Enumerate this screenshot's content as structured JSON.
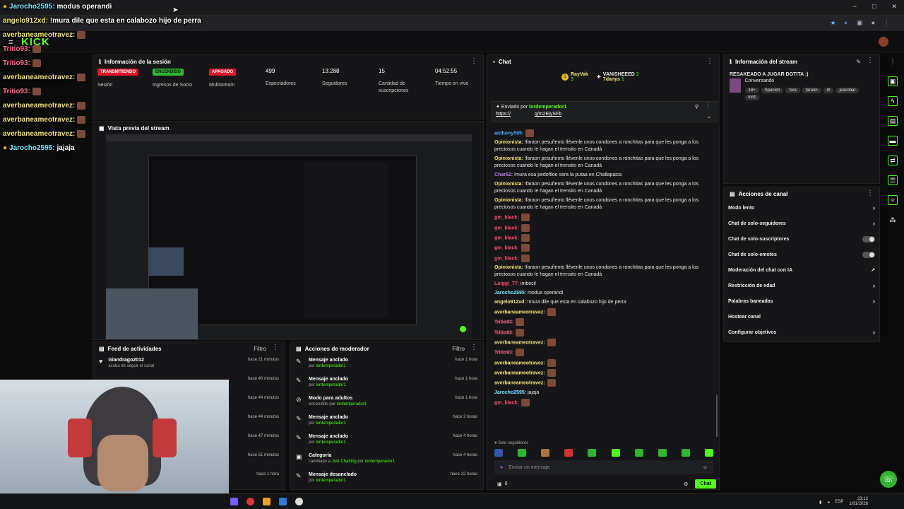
{
  "titlebar": {
    "win_min": "−",
    "win_max": "□",
    "win_close": "✕"
  },
  "overlay_chat": [
    {
      "user": "Jarocho2595:",
      "text": "modus operandi",
      "color": "#79e6ff",
      "badges": true
    },
    {
      "user": "angelo912xd:",
      "text": "!mura dile que esta en calabozo hijo de perra",
      "color": "#f0e37a",
      "badges": false
    },
    {
      "user": "averbaneameotravez:",
      "text": "",
      "color": "#f0e37a",
      "emote": true
    },
    {
      "user": "Tritio93:",
      "text": "",
      "color": "#ff6b8b",
      "emote": true
    },
    {
      "user": "Tritio93:",
      "text": "",
      "color": "#ff6b8b",
      "emote": true
    },
    {
      "user": "averbaneameotravez:",
      "text": "",
      "color": "#f0e37a",
      "emote": true
    },
    {
      "user": "Tritio93:",
      "text": "",
      "color": "#ff6b8b",
      "emote": true
    },
    {
      "user": "averbaneameotravez:",
      "text": "",
      "color": "#f0e37a",
      "emote": true
    },
    {
      "user": "averbaneameotravez:",
      "text": "",
      "color": "#f0e37a",
      "emote": true
    },
    {
      "user": "averbaneameotravez:",
      "text": "",
      "color": "#f0e37a",
      "emote": true
    },
    {
      "user": "Jarocho2595:",
      "text": "jajaja",
      "color": "#79e6ff",
      "badges": true
    }
  ],
  "logo": "KICK",
  "stream_info": {
    "title": "Información de la sesión",
    "stats": [
      {
        "badge": "TRANSMITIENDO",
        "badge_color": "#e0162b",
        "label": "Sesión"
      },
      {
        "badge": "ENCENDIDO",
        "badge_color": "#2fb52f",
        "label": "Ingresos de Socio"
      },
      {
        "badge": "APAGADO",
        "badge_color": "#e0162b",
        "label": "Multistream"
      },
      {
        "value": "499",
        "label": "Espectadores"
      },
      {
        "value": "13.288",
        "label": "Seguidores"
      },
      {
        "value": "15",
        "label": "Cantidad de suscripciones"
      },
      {
        "value": "04:52:55",
        "label": "Tiempo en vivo"
      }
    ]
  },
  "preview": {
    "title": "Vista previa del stream"
  },
  "feed": {
    "title": "Feed de actividades",
    "filter": "Filtro",
    "rows": [
      {
        "title": "Giandrago2012",
        "sub": "acaba de seguir el canal",
        "time": "hace 21 minutos"
      },
      {
        "title": "",
        "sub": "",
        "time": "hace 40 minutos"
      },
      {
        "title": "",
        "sub": "",
        "time": "hace 44 minutos"
      },
      {
        "title": "",
        "sub": "",
        "time": "hace 44 minutos"
      },
      {
        "title": "",
        "sub": "",
        "time": "hace 47 minutos"
      },
      {
        "title": "",
        "sub": "",
        "time": "hace 51 minutos"
      },
      {
        "title": "",
        "sub": "",
        "time": "hace 1 hora"
      }
    ]
  },
  "mod_actions": {
    "title": "Acciones de moderador",
    "filter": "Filtro",
    "rows": [
      {
        "title": "Mensaje anclado",
        "by": "por",
        "user": "lordemperador1",
        "time": "hace 1 hora"
      },
      {
        "title": "Mensaje anclado",
        "by": "por",
        "user": "lordemperador1",
        "time": "hace 1 hora"
      },
      {
        "title": "Modo para adultos",
        "by": "encendido por",
        "user": "lordemperador1",
        "time": "hace 1 hora"
      },
      {
        "title": "Mensaje anclado",
        "by": "por",
        "user": "lordemperador1",
        "time": "hace 3 horas"
      },
      {
        "title": "Mensaje anclado",
        "by": "por",
        "user": "lordemperador1",
        "time": "hace 4 horas"
      },
      {
        "title": "Categoría",
        "by": "cambiado a",
        "user": "Just Chatting",
        "by2": "por",
        "user2": "lordemperador1",
        "time": "hace 4 horas"
      },
      {
        "title": "Mensaje desanclado",
        "by": "por",
        "user": "lordemperador1",
        "time": "hace 22 horas"
      }
    ]
  },
  "chat": {
    "title": "Chat",
    "top_gifters": [
      {
        "name": "RayVak",
        "count": "3"
      },
      {
        "name": "VANISHEEED",
        "count": "2"
      },
      {
        "name": "7danys",
        "count": "1"
      }
    ],
    "pinned": {
      "label": "Enviado por",
      "user": "lordemperador1",
      "link": "https://",
      "link_tail": "g/m2EjySFb"
    },
    "messages": [
      {
        "user": "anthony595:",
        "text": "",
        "color": "#4aa8ff",
        "emote": true
      },
      {
        "user": "Opinionista:",
        "text": "!faraon pesuñento llévenle unos condones a ronchitas para que les ponga a los preciosos cuando le hagan el trensito en Canadá",
        "color": "#f0e37a"
      },
      {
        "user": "Opinionista:",
        "text": "!faraon pesuñento llévenle unos condones a ronchitas para que les ponga a los preciosos cuando le hagan el trensito en Canadá",
        "color": "#f0e37a"
      },
      {
        "user": "Char52:",
        "text": "!mura esa pedofiloo sera la putaa en Challapaica",
        "color": "#b77bff"
      },
      {
        "user": "Opinionista:",
        "text": "!faraon pesuñento llévenle unos condones a ronchitas para que les ponga a los preciosos cuando le hagan el trensito en Canadá",
        "color": "#f0e37a"
      },
      {
        "user": "Opinionista:",
        "text": "!faraon pesuñento llévenle unos condones a ronchitas para que les ponga a los preciosos cuando le hagan el trensito en Canadá",
        "color": "#f0e37a"
      },
      {
        "user": "gm_black:",
        "text": "",
        "color": "#ff4d6d",
        "emote": true
      },
      {
        "user": "gm_black:",
        "text": "",
        "color": "#ff4d6d",
        "emote": true
      },
      {
        "user": "gm_black:",
        "text": "",
        "color": "#ff4d6d",
        "emote": true
      },
      {
        "user": "gm_black:",
        "text": "",
        "color": "#ff4d6d",
        "emote": true
      },
      {
        "user": "gm_black:",
        "text": "",
        "color": "#ff4d6d",
        "emote": true
      },
      {
        "user": "Opinionista:",
        "text": "!faraon pesuñento llévenle unos condones a ronchitas para que les ponga a los preciosos cuando le hagan el trensito en Canadá",
        "color": "#f0e37a"
      },
      {
        "user": "Luiggi_77:",
        "text": "imbecil",
        "color": "#ff4d6d"
      },
      {
        "user": "Jarocho2595:",
        "text": "modus operandi",
        "color": "#79e6ff"
      },
      {
        "user": "angelo912xd:",
        "text": "!mura dile que esta en calabozo hijo de perra",
        "color": "#f0e37a"
      },
      {
        "user": "averbaneameotravez:",
        "text": "",
        "color": "#f0e37a",
        "emote": true
      },
      {
        "user": "Tritio93:",
        "text": "",
        "color": "#ff6b8b",
        "emote": true
      },
      {
        "user": "Tritio93:",
        "text": "",
        "color": "#ff6b8b",
        "emote": true
      },
      {
        "user": "averbaneameotravez:",
        "text": "",
        "color": "#f0e37a",
        "emote": true
      },
      {
        "user": "Tritio93:",
        "text": "",
        "color": "#ff6b8b",
        "emote": true
      },
      {
        "user": "averbaneameotravez:",
        "text": "",
        "color": "#f0e37a",
        "emote": true
      },
      {
        "user": "averbaneameotravez:",
        "text": "",
        "color": "#f0e37a",
        "emote": true
      },
      {
        "user": "averbaneameotravez:",
        "text": "",
        "color": "#f0e37a",
        "emote": true
      },
      {
        "user": "Jarocho2595:",
        "text": "jajaja",
        "color": "#79e6ff"
      },
      {
        "user": "gm_black:",
        "text": "",
        "color": "#ff4d6d",
        "emote": true
      }
    ],
    "followers_only": "Solo seguidores",
    "input_placeholder": "Enviar un mensaje",
    "points": "0",
    "send": "Chat"
  },
  "stream_panel": {
    "title": "Información del stream",
    "stream_title": "RESAKEADO A JUGAR DOTITA :)",
    "category": "Conversando",
    "tags": [
      "18+",
      "Spanish",
      "fara",
      "faraon",
      "lrl",
      "jeacobar",
      "lord"
    ]
  },
  "channel_actions": {
    "title": "Acciones de canal",
    "items": [
      {
        "label": "Modo lento",
        "type": "arrow"
      },
      {
        "label": "Chat de solo-seguidores",
        "type": "arrow"
      },
      {
        "label": "Chat de solo-suscriptores",
        "type": "toggle"
      },
      {
        "label": "Chat de solo-emotes",
        "type": "toggle"
      },
      {
        "label": "Moderación del chat con IA",
        "type": "ext"
      },
      {
        "label": "Restricción de edad",
        "type": "arrow"
      },
      {
        "label": "Palabras baneadas",
        "type": "arrow"
      },
      {
        "label": "Hostear canal",
        "type": "none"
      },
      {
        "label": "Configurar objetivos",
        "type": "arrow"
      }
    ]
  },
  "taskbar": {
    "lang": "ESP",
    "time": "23:12",
    "date": "1/01/2026"
  },
  "colors": {
    "accent": "#53fc18",
    "live": "#e0162b"
  }
}
